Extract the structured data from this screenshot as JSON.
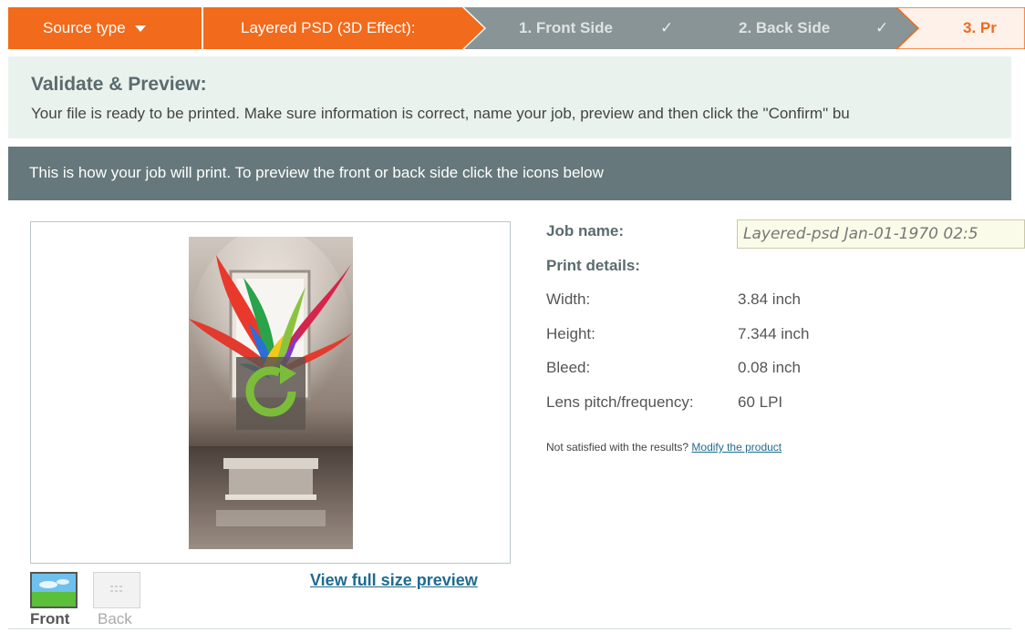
{
  "stepbar": {
    "source_type": "Source type",
    "layered": "Layered PSD (3D Effect):",
    "step1": "1. Front Side",
    "step2": "2. Back Side",
    "step3": "3. Pr",
    "check": "✓",
    "colors": {
      "orange": "#f26a1b",
      "gray": "#889496",
      "active_bg": "#fdf1e9"
    }
  },
  "validate": {
    "title": "Validate & Preview:",
    "text": "Your file is ready to be printed. Make sure information is correct, name your job, preview and then click the \"Confirm\" bu"
  },
  "infobar": {
    "text": "This is how your job will print. To preview the front or back side click the icons below"
  },
  "preview": {
    "view_full": "View full size preview",
    "front_label": "Front",
    "back_label": "Back",
    "refresh_icon": "refresh-icon"
  },
  "details": {
    "job_name_label": "Job name:",
    "job_name_value": "Layered-psd Jan-01-1970 02:5",
    "print_details_label": "Print details:",
    "rows": [
      {
        "label": "Width:",
        "value": "3.84 inch"
      },
      {
        "label": "Height:",
        "value": "7.344 inch"
      },
      {
        "label": "Bleed:",
        "value": "0.08 inch"
      },
      {
        "label": "Lens pitch/frequency:",
        "value": "60 LPI"
      }
    ],
    "note_text": "Not satisfied with the results?",
    "note_link": "Modify the product"
  }
}
